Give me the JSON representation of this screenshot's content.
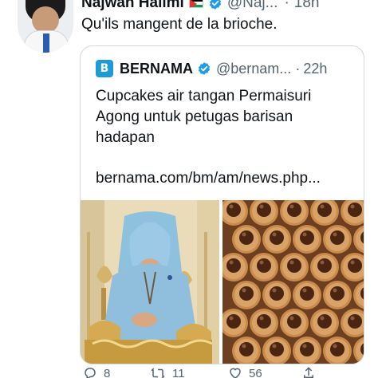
{
  "tweet": {
    "author_name": "Najwan Halimi",
    "author_handle": "@Naj...",
    "separator": "·",
    "time": "18h",
    "text": "Qu'ils mangent de la brioche."
  },
  "quoted_tweet": {
    "logo_letter": "B",
    "author_name": "BERNAMA",
    "author_handle": "@bernam...",
    "separator": "·",
    "time": "22h",
    "text_lines": [
      "Cupcakes air tangan Permaisuri",
      "Agong untuk petugas barisan",
      "hadapan"
    ],
    "link": "bernama.com/bm/am/news.php..."
  },
  "actions": {
    "replies": "8",
    "retweets": "11",
    "likes": "56"
  },
  "colors": {
    "text_primary": "#0f1419",
    "text_secondary": "#536471",
    "verified_blue": "#1d9bf0",
    "border": "#cfd9de",
    "bernama_blue": "#1d9bd7"
  }
}
